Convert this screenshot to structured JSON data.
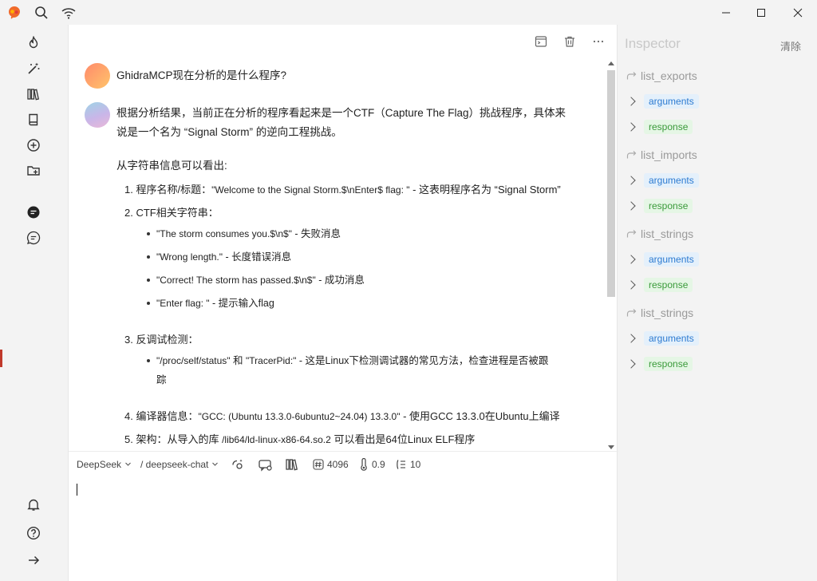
{
  "window": {
    "minimize_icon": "minimize-icon",
    "maximize_icon": "maximize-icon",
    "close_icon": "close-icon"
  },
  "main_toolbar": {
    "icons": [
      "terminal-icon",
      "trash-icon",
      "more-icon"
    ]
  },
  "chat": {
    "user_message": "GhidraMCP现在分析的是什么程序?",
    "bot_intro_line1": "根据分析结果，当前正在分析的程序看起来是一个CTF（Capture The Flag）挑战程序，具体来",
    "bot_intro_line2": "说是一个名为 “Signal Storm” 的逆向工程挑战。",
    "section_heading": "从字符串信息可以看出:",
    "item1_label": "1. 程序名称/标题：",
    "item1_code": "\"Welcome to the Signal Storm.$\\nEnter$ flag: \"",
    "item1_rest": " - 这表明程序名为 “Signal Storm”",
    "item2_label": "2. CTF相关字符串：",
    "item2_bullets": [
      {
        "code": "\"The storm consumes you.$\\n$\"",
        "rest": " - 失败消息"
      },
      {
        "code": "\"Wrong length.\"",
        "rest": " - 长度错误消息"
      },
      {
        "code": "\"Correct! The storm has passed.$\\n$\"",
        "rest": " - 成功消息"
      },
      {
        "code": "\"Enter flag: \"",
        "rest": " - 提示输入flag"
      }
    ],
    "item3_label": "3. 反调试检测：",
    "item3_bullet_line1_code1": "\"/proc/self/status\"",
    "item3_bullet_line1_mid": " 和 ",
    "item3_bullet_line1_code2": "\"TracerPid:\"",
    "item3_bullet_line1_rest": " - 这是Linux下检测调试器的常见方法，检查进程是否被跟",
    "item3_bullet_line2": "踪",
    "item4_label": "4. 编译器信息：",
    "item4_code": "\"GCC: (Ubuntu 13.3.0-6ubuntu2~24.04) 13.3.0\"",
    "item4_rest": " - 使用GCC 13.3.0在Ubuntu上编译",
    "item5_label": "5. 架构：从导入的库 ",
    "item5_code": "/lib64/ld-linux-x86-64.so.2",
    "item5_rest": " 可以看出是64位Linux ELF程序"
  },
  "composer": {
    "provider": "DeepSeek",
    "model": "/ deepseek-chat",
    "max_tokens": "4096",
    "temperature": "0.9",
    "context_count": "10"
  },
  "inspector": {
    "title": "Inspector",
    "clear_label": "清除",
    "tools": [
      {
        "name": "list_exports",
        "args_label": "arguments",
        "resp_label": "response"
      },
      {
        "name": "list_imports",
        "args_label": "arguments",
        "resp_label": "response"
      },
      {
        "name": "list_strings",
        "args_label": "arguments",
        "resp_label": "response"
      },
      {
        "name": "list_strings",
        "args_label": "arguments",
        "resp_label": "response"
      }
    ]
  },
  "colors": {
    "args_tag": "#2d7bd1",
    "resp_tag": "#3a9a3a",
    "inspector_title": "#c8c8c8"
  }
}
